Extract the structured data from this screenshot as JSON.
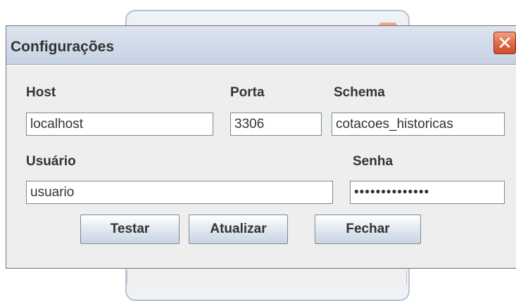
{
  "dialog": {
    "title": "Configurações",
    "close_label": "✕"
  },
  "form": {
    "host_label": "Host",
    "host_value": "localhost",
    "porta_label": "Porta",
    "porta_value": "3306",
    "schema_label": "Schema",
    "schema_value": "cotacoes_historicas",
    "usuario_label": "Usuário",
    "usuario_value": "usuario",
    "senha_label": "Senha",
    "senha_value": "••••••••••••••"
  },
  "buttons": {
    "testar": "Testar",
    "atualizar": "Atualizar",
    "fechar": "Fechar"
  },
  "colors": {
    "titlebar": "#c7d2e3",
    "close_button": "#e06a47",
    "dialog_background": "#eeeeee"
  },
  "icons": {
    "close": "close-icon"
  }
}
